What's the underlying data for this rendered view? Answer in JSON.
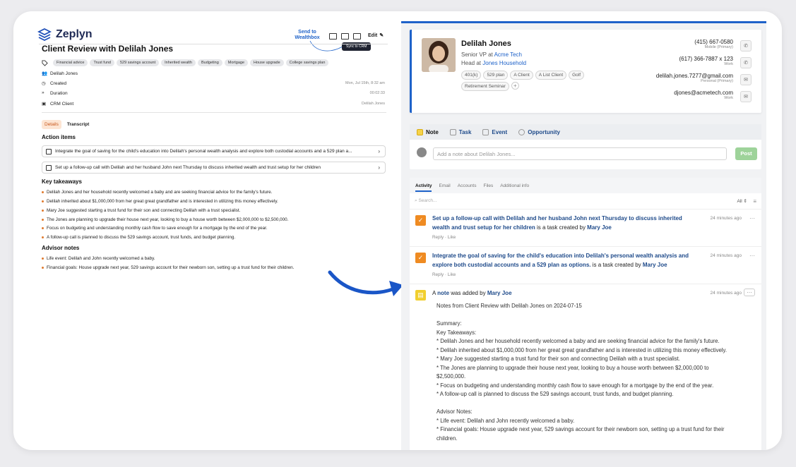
{
  "left": {
    "brand": "Zeplyn",
    "send_to": "Send to Wealthbox",
    "edit_label": "Edit",
    "tooltip": "Sync to CRM",
    "title": "Client Review with Delilah Jones",
    "tags": [
      "Financial advice",
      "Trust fund",
      "529 savings account",
      "Inherited wealth",
      "Budgeting",
      "Mortgage",
      "House upgrade",
      "College savings plan"
    ],
    "client_name": "Delilah Jones",
    "created_label": "Created",
    "created_value": "Mon, Jul 15th, 8:32 am",
    "duration_label": "Duration",
    "duration_value": "00:02:33",
    "crm_label": "CRM Client",
    "crm_value": "Delilah Jones",
    "tab_details": "Details",
    "tab_transcript": "Transcript",
    "action_items_heading": "Action items",
    "action_items": [
      "Integrate the goal of saving for the child's education into Delilah's personal wealth analysis and explore both custodial accounts and a 529 plan a...",
      "Set up a follow-up call with Delilah and her husband John next Thursday to discuss inherited wealth and trust setup for her children"
    ],
    "key_takeaways_heading": "Key takeaways",
    "key_takeaways": [
      "Delilah Jones and her household recently welcomed a baby and are seeking financial advice for the family's future.",
      "Delilah inherited about $1,000,000 from her great great grandfather and is interested in utilizing this money effectively.",
      "Mary Joe suggested starting a trust fund for their son and connecting Delilah with a trust specialist.",
      "The Jones are planning to upgrade their house next year, looking to buy a house worth between $2,000,000 to $2,500,000.",
      "Focus on budgeting and understanding monthly cash flow to save enough for a mortgage by the end of the year.",
      "A follow-up call is planned to discuss the 529 savings account, trust funds, and budget planning."
    ],
    "advisor_notes_heading": "Advisor notes",
    "advisor_notes": [
      "Life event: Delilah and John recently welcomed a baby.",
      "Financial goals: House upgrade next year, 529 savings account for their newborn son, setting up a trust fund for their children."
    ]
  },
  "contact": {
    "name": "Delilah Jones",
    "role_prefix": "Senior VP at ",
    "company": "Acme Tech",
    "head_prefix": "Head at ",
    "household": "Jones Household",
    "tags": [
      "401(k)",
      "529 plan",
      "A Client",
      "A List Client",
      "Golf",
      "Retirement Seminar"
    ],
    "plus": "+",
    "phones": [
      {
        "value": "(415) 667-0580",
        "label": "Mobile (Primary)"
      },
      {
        "value": "(617) 366-7887 x 123",
        "label": "Work"
      }
    ],
    "emails": [
      {
        "value": "delilah.jones.7277@gmail.com",
        "label": "Personal (Primary)"
      },
      {
        "value": "djones@acmetech.com",
        "label": "Work"
      }
    ]
  },
  "composer": {
    "tabs": [
      "Note",
      "Task",
      "Event",
      "Opportunity"
    ],
    "placeholder": "Add a note about Delilah Jones...",
    "post": "Post"
  },
  "feed": {
    "tabs": [
      "Activity",
      "Email",
      "Accounts",
      "Files",
      "Additional info"
    ],
    "search_placeholder": "Search...",
    "filter_all": "All",
    "reply_like": "Reply · Like",
    "items": [
      {
        "title": "Set up a follow-up call with Delilah and her husband John next Thursday to discuss inherited wealth and trust setup for her children",
        "suffix": " is a task created by ",
        "author": "Mary Joe",
        "time": "24 minutes ago"
      },
      {
        "title": "Integrate the goal of saving for the child's education into Delilah's personal wealth analysis and explore both custodial accounts and a 529 plan as options.",
        "suffix": " is a task created by ",
        "author": "Mary Joe",
        "time": "24 minutes ago"
      }
    ],
    "note_prefix": "A ",
    "note_word": "note",
    "note_suffix": " was added by ",
    "note_author": "Mary Joe",
    "note_time": "24 minutes ago",
    "note_body": "Notes from Client Review with Delilah Jones on 2024-07-15\n\nSummary:\nKey Takeaways:\n* Delilah Jones and her household recently welcomed a baby and are seeking financial advice for the family's future.\n* Delilah inherited about $1,000,000 from her great great grandfather and is interested in utilizing this money effectively.\n* Mary Joe suggested starting a trust fund for their son and connecting Delilah with a trust specialist.\n* The Jones are planning to upgrade their house next year, looking to buy a house worth between $2,000,000 to\n$2,500,000.\n* Focus on budgeting and understanding monthly cash flow to save enough for a mortgage by the end of the year.\n* A follow-up call is planned to discuss the 529 savings account, trust funds, and budget planning.\n\nAdvisor Notes:\n* Life event: Delilah and John recently welcomed a baby.\n* Financial goals: House upgrade next year, 529 savings account for their newborn son, setting up a trust fund for their\nchildren."
  }
}
